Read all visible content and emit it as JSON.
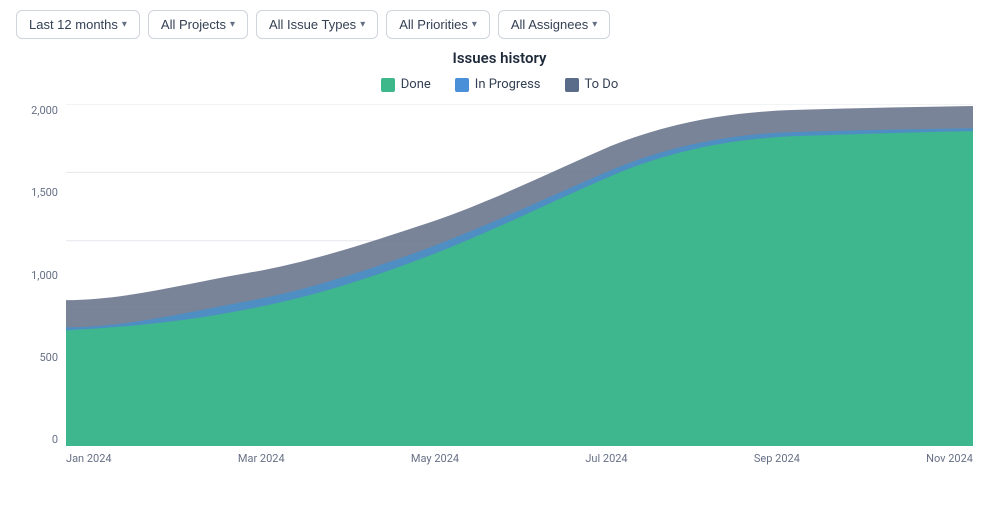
{
  "toolbar": {
    "filters": [
      {
        "label": "Last 12 months",
        "id": "time-filter"
      },
      {
        "label": "All Projects",
        "id": "projects-filter"
      },
      {
        "label": "All Issue Types",
        "id": "issue-types-filter"
      },
      {
        "label": "All Priorities",
        "id": "priorities-filter"
      },
      {
        "label": "All Assignees",
        "id": "assignees-filter"
      }
    ]
  },
  "chart": {
    "title": "Issues history",
    "legend": [
      {
        "label": "Done",
        "color": "#3db88b",
        "id": "done"
      },
      {
        "label": "In Progress",
        "color": "#4a90d9",
        "id": "in-progress"
      },
      {
        "label": "To Do",
        "color": "#5b6b8a",
        "id": "to-do"
      }
    ],
    "yAxis": {
      "labels": [
        "2,000",
        "1,500",
        "1,000",
        "500",
        "0"
      ]
    },
    "xAxis": {
      "labels": [
        "Jan 2024",
        "Mar 2024",
        "May 2024",
        "Jul 2024",
        "Sep 2024",
        "Nov 2024"
      ]
    },
    "colors": {
      "done": "#3db88b",
      "inProgress": "#4a90d9",
      "toDo": "#636e87",
      "grid": "#e5e7eb"
    }
  }
}
